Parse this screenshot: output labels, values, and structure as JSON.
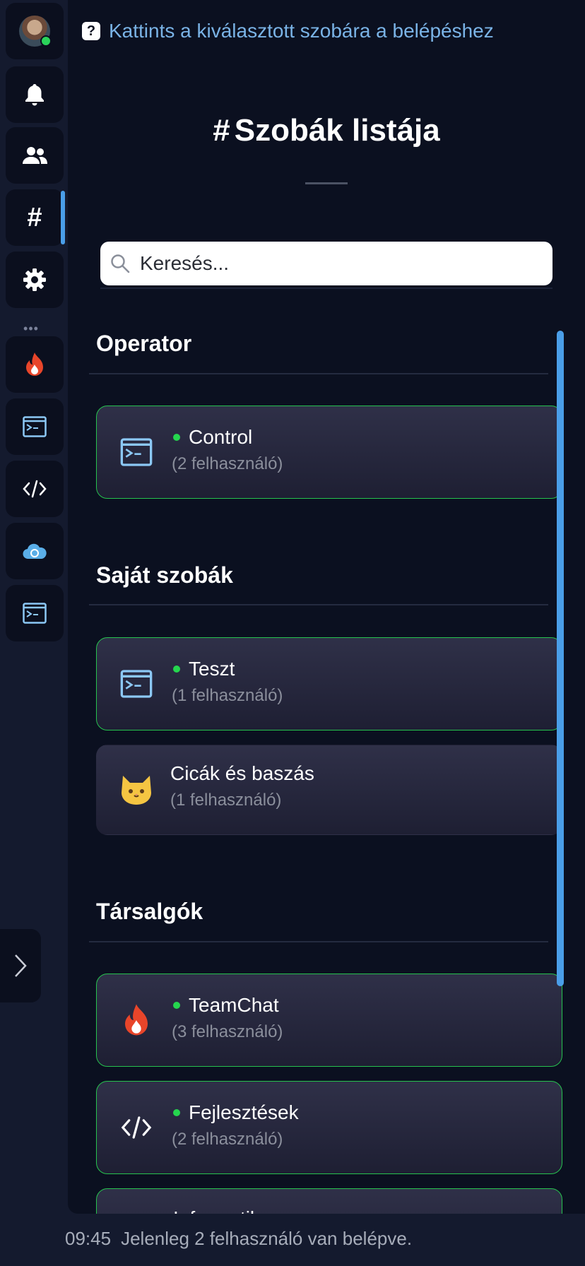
{
  "sidebar": {
    "items": [
      {
        "name": "avatar"
      },
      {
        "name": "bell-icon"
      },
      {
        "name": "users-icon"
      },
      {
        "name": "hash-icon",
        "active": true
      },
      {
        "name": "gear-icon"
      },
      {
        "name": "fire-icon"
      },
      {
        "name": "terminal-icon"
      },
      {
        "name": "code-icon"
      },
      {
        "name": "cloud-icon"
      },
      {
        "name": "terminal-icon"
      }
    ],
    "separator": "•••"
  },
  "hint": "Kattints a kiválasztott szobára a belépéshez",
  "page_title": "Szobák listája",
  "page_title_icon": "#",
  "search": {
    "placeholder": "Keresés..."
  },
  "sections": [
    {
      "title": "Operator",
      "rooms": [
        {
          "icon": "terminal-icon",
          "name": "Control",
          "count": "(2 felhasználó)",
          "online": true
        }
      ]
    },
    {
      "title": "Saját szobák",
      "rooms": [
        {
          "icon": "terminal-icon",
          "name": "Teszt",
          "count": "(1 felhasználó)",
          "online": true
        },
        {
          "icon": "cat-icon",
          "name": "Cicák és baszás",
          "count": "(1 felhasználó)",
          "online": false
        }
      ]
    },
    {
      "title": "Társalgók",
      "rooms": [
        {
          "icon": "fire-icon",
          "name": "TeamChat",
          "count": "(3 felhasználó)",
          "online": true
        },
        {
          "icon": "code-icon",
          "name": "Fejlesztések",
          "count": "(2 felhasználó)",
          "online": true
        },
        {
          "icon": "",
          "name": "Informatika",
          "count": "",
          "online": true
        }
      ]
    }
  ],
  "status": {
    "time": "09:45",
    "message": "Jelenleg 2 felhasználó van belépve."
  },
  "colors": {
    "online": "#25d64e",
    "accent": "#4a9ee8",
    "hint": "#7ab3e6"
  }
}
